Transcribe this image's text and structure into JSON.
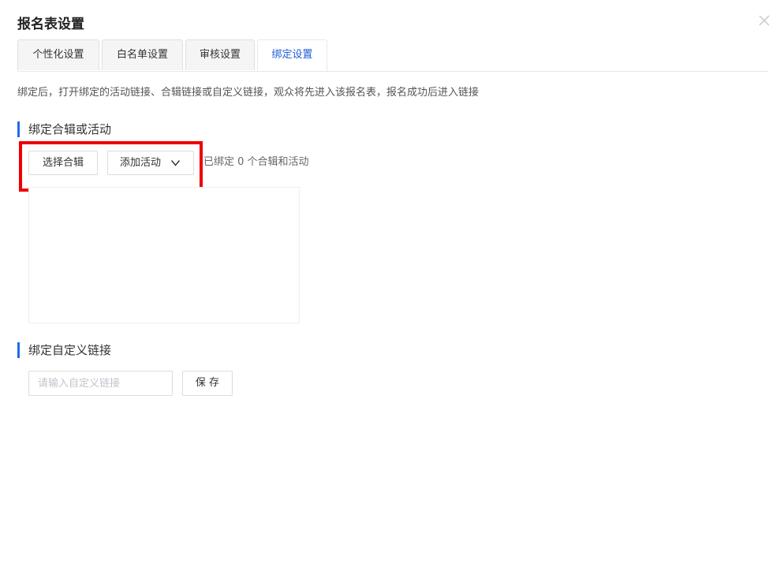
{
  "dialog": {
    "title": "报名表设置",
    "close_icon": "close-icon"
  },
  "tabs": [
    {
      "label": "个性化设置",
      "active": false
    },
    {
      "label": "白名单设置",
      "active": false
    },
    {
      "label": "审核设置",
      "active": false
    },
    {
      "label": "绑定设置",
      "active": true
    }
  ],
  "description": "绑定后，打开绑定的活动链接、合辑链接或自定义链接，观众将先进入该报名表，报名成功后进入链接",
  "bind_section": {
    "title": "绑定合辑或活动",
    "select_album_label": "选择合辑",
    "add_activity_label": "添加活动",
    "add_activity_icon": "chevron-down-icon",
    "bound_count_text": "已绑定 0 个合辑和活动"
  },
  "custom_link_section": {
    "title": "绑定自定义链接",
    "input_value": "",
    "input_placeholder": "请输入自定义链接",
    "save_label": "保 存"
  },
  "colors": {
    "accent": "#1e5fd8",
    "section_bar": "#2468e8",
    "highlight": "#ee0000"
  }
}
